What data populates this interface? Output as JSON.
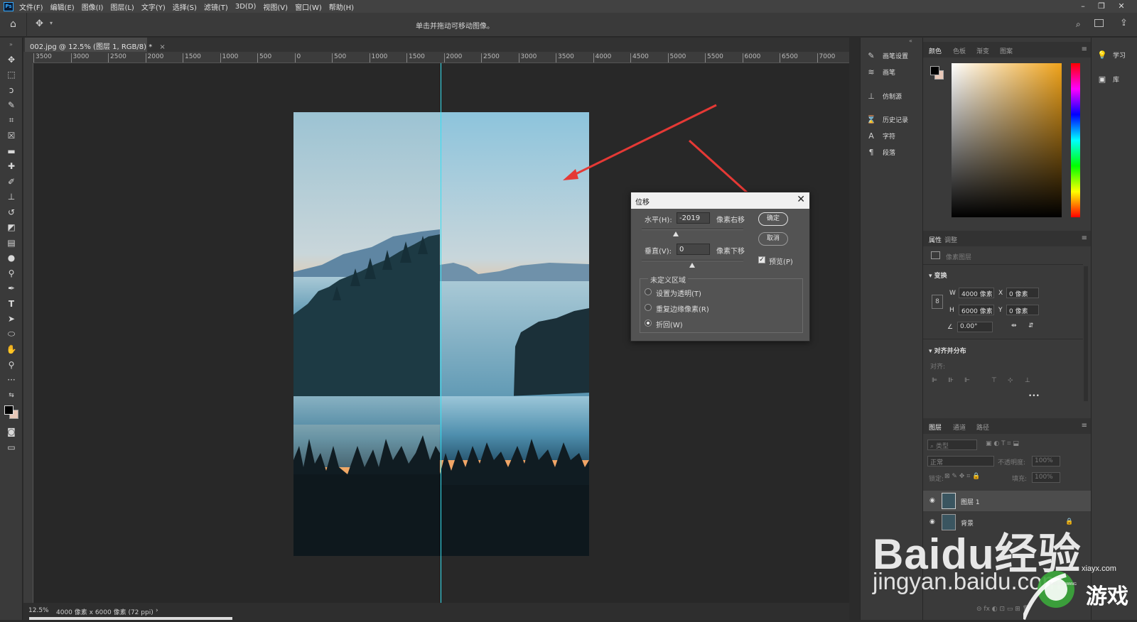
{
  "menubar": {
    "app_icon": "Ps",
    "items": [
      "文件(F)",
      "编辑(E)",
      "图像(I)",
      "图层(L)",
      "文字(Y)",
      "选择(S)",
      "滤镜(T)",
      "3D(D)",
      "视图(V)",
      "窗口(W)",
      "帮助(H)"
    ]
  },
  "optionsbar": {
    "hint": "单击并拖动可移动图像。"
  },
  "document": {
    "tab_title": "002.jpg @ 12.5% (图层 1, RGB/8) *",
    "tab_close": "×"
  },
  "ruler": {
    "h_ticks": [
      "3500",
      "3000",
      "2500",
      "2000",
      "1500",
      "1000",
      "500",
      "0",
      "500",
      "1000",
      "1500",
      "2000",
      "2500",
      "3000",
      "3500",
      "4000",
      "4500",
      "5000",
      "5500",
      "6000",
      "6500",
      "7000"
    ]
  },
  "status": {
    "zoom": "12.5%",
    "doc_info": "4000 像素 x 6000 像素 (72 ppi)",
    "arrow": "›"
  },
  "dialog": {
    "title": "位移",
    "close": "✕",
    "horizontal_label": "水平(H):",
    "horizontal_value": "-2019",
    "horizontal_unit": "像素右移",
    "vertical_label": "垂直(V):",
    "vertical_value": "0",
    "vertical_unit": "像素下移",
    "ok_label": "确定",
    "cancel_label": "取消",
    "preview_label": "预览(P)",
    "preview_checked": true,
    "undefined_area_label": "未定义区域",
    "options": [
      {
        "label": "设置为透明(T)",
        "selected": false
      },
      {
        "label": "重复边缘像素(R)",
        "selected": false
      },
      {
        "label": "折回(W)",
        "selected": true
      }
    ]
  },
  "panel_strip": {
    "items": [
      {
        "label": "画笔设置",
        "icon": "brush-settings-icon"
      },
      {
        "label": "画笔",
        "icon": "brush-icon"
      },
      {
        "label": "仿制源",
        "icon": "clone-source-icon"
      },
      {
        "label": "历史记录",
        "icon": "history-icon"
      },
      {
        "label": "字符",
        "icon": "character-icon"
      },
      {
        "label": "段落",
        "icon": "paragraph-icon"
      }
    ]
  },
  "color_panel": {
    "tabs": [
      "颜色",
      "色板",
      "渐变",
      "图案"
    ]
  },
  "properties_panel": {
    "tabs": [
      "属性",
      "调整"
    ],
    "layer_type": "像素图层",
    "transform_title": "变换",
    "w_label": "W",
    "w_value": "4000 像素",
    "h_label": "H",
    "h_value": "6000 像素",
    "x_label": "X",
    "x_value": "0 像素",
    "y_label": "Y",
    "y_value": "0 像素",
    "angle_value": "0.00°",
    "align_title": "对齐并分布",
    "align_sub": "对齐:",
    "more": "•••"
  },
  "layers_panel": {
    "tabs": [
      "图层",
      "通道",
      "路径"
    ],
    "filter_placeholder": "类型",
    "blend_mode": "正常",
    "opacity_label": "不透明度:",
    "opacity_value": "100%",
    "lock_label": "锁定:",
    "fill_label": "填充:",
    "fill_value": "100%",
    "layers": [
      "图层 1",
      "背景"
    ]
  },
  "far_strip": {
    "items": [
      {
        "label": "学习",
        "icon": "lightbulb-icon"
      },
      {
        "label": "库",
        "icon": "library-icon"
      }
    ]
  },
  "watermark": {
    "brand": "Baidu经验",
    "url": "jingyan.baidu.com",
    "site": "xiayx.com",
    "game_text": "游戏",
    "pinyin": "XIAYOUXIWANG"
  },
  "colors": {
    "guide": "#38e0f0",
    "arrow": "#e53935",
    "accent": "#31a8ff"
  }
}
